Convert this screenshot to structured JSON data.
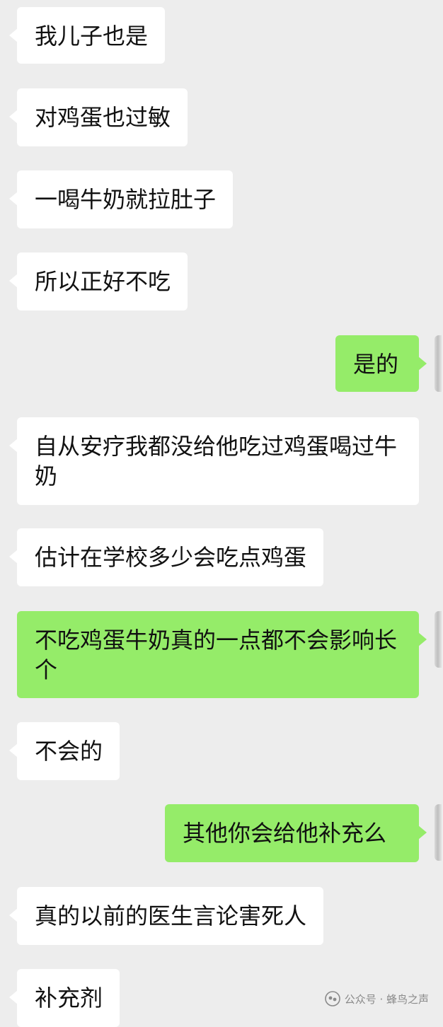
{
  "messages": [
    {
      "side": "in",
      "text": "我儿子也是"
    },
    {
      "side": "in",
      "text": "对鸡蛋也过敏"
    },
    {
      "side": "in",
      "text": "一喝牛奶就拉肚子"
    },
    {
      "side": "in",
      "text": "所以正好不吃"
    },
    {
      "side": "out",
      "text": "是的"
    },
    {
      "side": "in",
      "text": "自从安疗我都没给他吃过鸡蛋喝过牛奶"
    },
    {
      "side": "in",
      "text": "估计在学校多少会吃点鸡蛋"
    },
    {
      "side": "out",
      "text": "不吃鸡蛋牛奶真的一点都不会影响长个"
    },
    {
      "side": "in",
      "text": "不会的"
    },
    {
      "side": "out",
      "text": "其他你会给他补充么"
    },
    {
      "side": "in",
      "text": "真的以前的医生言论害死人"
    },
    {
      "side": "in",
      "text": "补充剂"
    }
  ],
  "watermark": {
    "icon": "wechat-official-account-icon",
    "text": "公众号 · 蜂鸟之声"
  },
  "colors": {
    "background": "#ededed",
    "incoming_bubble": "#ffffff",
    "outgoing_bubble": "#95ec69",
    "text": "#111111"
  }
}
